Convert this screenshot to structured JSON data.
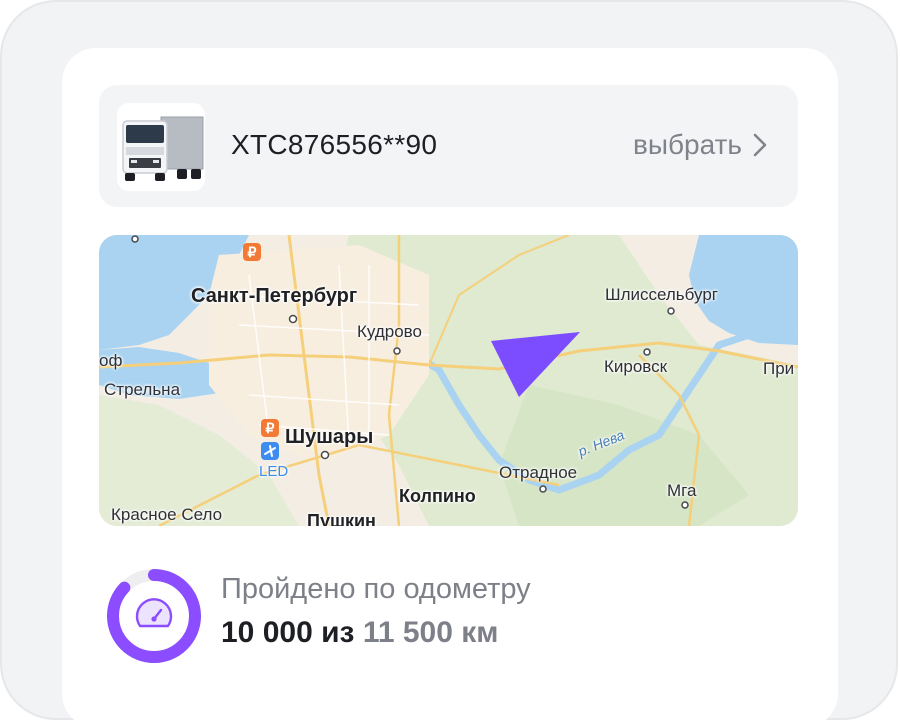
{
  "vehicle": {
    "plate": "XTC876556**90",
    "choose_label": "выбрать",
    "thumbnail_icon": "truck-image"
  },
  "map": {
    "labels": {
      "spb": "Санкт-Петербург",
      "shlisselburg": "Шлиссельбург",
      "kudrovo": "Кудрово",
      "kirovsk": "Кировск",
      "pri": "При",
      "of": "оф",
      "strelna": "Стрельна",
      "shushary": "Шушары",
      "led": "LED",
      "river": "р. Нева",
      "otradnoe": "Отрадное",
      "kolpino": "Колпино",
      "mga": "Мга",
      "krasnoe": "Красное Село",
      "pushkin": "Пушкин"
    },
    "marker_color": "#7b4dff"
  },
  "odometer": {
    "title": "Пройдено по одометру",
    "current": "10 000",
    "of": "из",
    "total": "11 500 км",
    "progress_fraction": 0.87,
    "accent": "#8b4dff"
  }
}
